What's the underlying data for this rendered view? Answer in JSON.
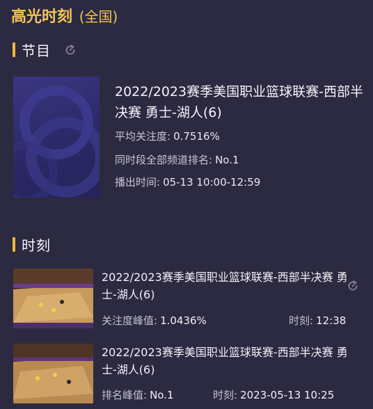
{
  "header": {
    "title": "高光时刻",
    "scope": "(全国)"
  },
  "program_section": {
    "title": "节目",
    "refresh_icon": "refresh-icon",
    "program": {
      "title": "2022/2023赛季美国职业篮球联赛-西部半决赛 勇士-湖人(6)",
      "avg_attention_label": "平均关注度:",
      "avg_attention_value": "0.7516%",
      "rank_label": "同时段全部频道排名:",
      "rank_value": "No.1",
      "air_time_label": "播出时间:",
      "air_time_value": "05-13 10:00-12:59"
    }
  },
  "moments_section": {
    "title": "时刻",
    "items": [
      {
        "title": "2022/2023赛季美国职业篮球联赛-西部半决赛 勇士-湖人(6)",
        "metric_label": "关注度峰值:",
        "metric_value": "1.0436%",
        "time_label": "时刻:",
        "time_value": "12:38",
        "has_refresh_icon": true
      },
      {
        "title": "2022/2023赛季美国职业篮球联赛-西部半决赛 勇士-湖人(6)",
        "metric_label": "排名峰值:",
        "metric_value": "No.1",
        "time_label": "时刻:",
        "time_value": "2023-05-13 10:25",
        "has_refresh_icon": false
      }
    ]
  },
  "colors": {
    "background": "#2c2a41",
    "accent": "#f1b73c",
    "title_gold": "#f3c35a"
  }
}
